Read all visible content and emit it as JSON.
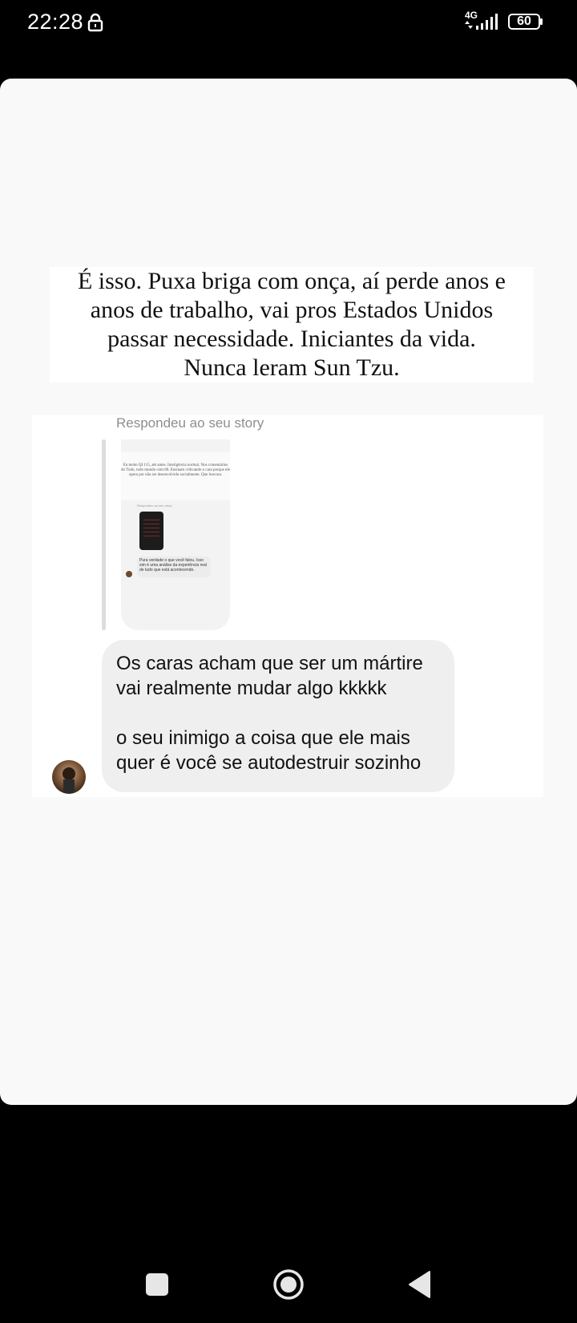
{
  "status_bar": {
    "time": "22:28",
    "network": "4G",
    "battery": "60",
    "icons": [
      "lock-icon",
      "signal-icon",
      "battery-icon"
    ]
  },
  "story": {
    "lines": [
      "É isso. Puxa briga com onça, aí perde anos e",
      "anos de trabalho, vai pros Estados Unidos",
      "passar necessidade. Iniciantes da vida.",
      "Nunca leram Sun Tzu."
    ]
  },
  "dm": {
    "replied_label": "Respondeu ao seu story",
    "message_paragraphs": [
      "Os caras acham que ser um mártire vai realmente mudar algo kkkkk",
      "o seu inimigo a coisa que ele mais quer é você se autodestruir sozinho"
    ],
    "thumbnail": {
      "story_text": "Eu tenho QI 115, até antes. Inteligência normal. Nos comentários do Tudo, todo mundo com 80. Ensinam criticando o cara porque ele opera por não ser desenvolvido socialmente. Que louvura.",
      "reply_label": "Respondeu ao seu story",
      "reply_text": "Pura verdade o que você falou. Isso sim é uma análise da experiência real de tudo que está acontecendo."
    }
  },
  "nav": {
    "icons": [
      "recents-button-icon",
      "home-button-icon",
      "back-button-icon"
    ]
  },
  "colors": {
    "card_bg": "#f9f9f9",
    "bubble_bg": "#efefef",
    "secondary_text": "#8e8e8e"
  }
}
